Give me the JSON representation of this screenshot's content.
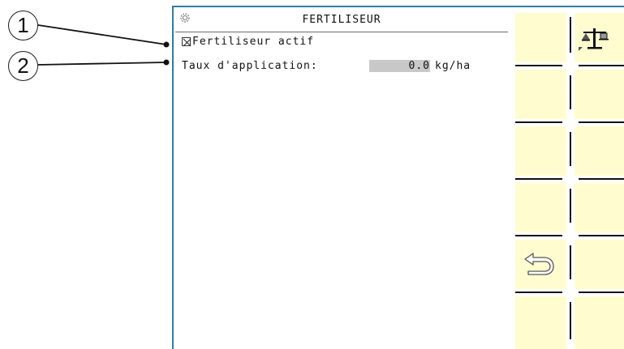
{
  "callouts": [
    "1",
    "2"
  ],
  "screen": {
    "title": "FERTILISEUR",
    "title_icon": "gear-icon",
    "accent_color": "#2f7ea0",
    "softkey_color": "#fffdd0"
  },
  "fertilizer_active": {
    "label": "Fertiliseur actif",
    "checked": true
  },
  "application_rate": {
    "label": "Taux d'application:",
    "value": "0.0",
    "unit": "kg/ha"
  },
  "softkeys": {
    "right_column": [
      {
        "icon": "scale-icon"
      },
      {
        "icon": ""
      },
      {
        "icon": ""
      },
      {
        "icon": ""
      },
      {
        "icon": ""
      },
      {
        "icon": ""
      }
    ],
    "left_column": [
      {
        "icon": ""
      },
      {
        "icon": ""
      },
      {
        "icon": ""
      },
      {
        "icon": ""
      },
      {
        "icon": "return-arrow-icon"
      },
      {
        "icon": ""
      }
    ]
  }
}
